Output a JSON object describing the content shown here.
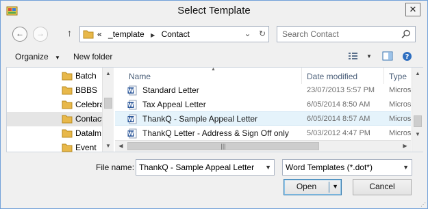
{
  "window": {
    "title": "Select Template",
    "close_glyph": "✕"
  },
  "navbar": {
    "back_glyph": "←",
    "forward_glyph": "→",
    "up_glyph": "↑",
    "address_overflow": "«",
    "address_parts": [
      "_template",
      "Contact"
    ],
    "refresh_glyph": "↻",
    "search_placeholder": "Search Contact"
  },
  "toolbar": {
    "organize": "Organize",
    "organize_chevron": "▼",
    "new_folder": "New folder",
    "view_chevron": "▼",
    "help_glyph": "?"
  },
  "tree": {
    "items": [
      {
        "label": "Batch"
      },
      {
        "label": "BBBS"
      },
      {
        "label": "Celebra"
      },
      {
        "label": "Contact"
      },
      {
        "label": "Datalm"
      },
      {
        "label": "Event"
      }
    ],
    "selected_index": 3
  },
  "files": {
    "columns": [
      "Name",
      "Date modified",
      "Type"
    ],
    "rows": [
      {
        "name": "Standard Letter",
        "date": "23/07/2013 5:57 PM",
        "type": "Micros"
      },
      {
        "name": "Tax Appeal Letter",
        "date": "6/05/2014 8:50 AM",
        "type": "Micros"
      },
      {
        "name": "ThankQ - Sample Appeal Letter",
        "date": "6/05/2014 8:57 AM",
        "type": "Micros"
      },
      {
        "name": "ThankQ Letter - Address & Sign Off only",
        "date": "5/03/2012 4:47 PM",
        "type": "Micros"
      }
    ],
    "selected_index": 2
  },
  "bottom": {
    "file_name_label": "File name:",
    "file_name_value": "ThankQ - Sample Appeal Letter",
    "file_type_value": "Word Templates (*.dot*)",
    "open_label": "Open",
    "cancel_label": "Cancel"
  },
  "colors": {
    "window_border": "#6f9fd8",
    "selection": "#e5f3fb",
    "word_blue": "#2b579a",
    "folder_yellow": "#e8b84a"
  }
}
